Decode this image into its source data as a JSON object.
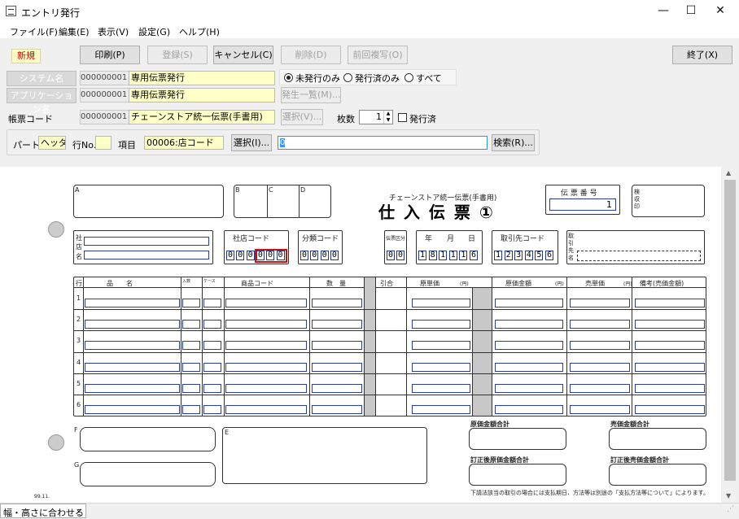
{
  "window": {
    "title": "エントリ発行",
    "minimize": "—",
    "maximize": "☐",
    "close": "✕"
  },
  "menu": [
    "ファイル(F)",
    "編集(E)",
    "表示(V)",
    "設定(G)",
    "ヘルプ(H)"
  ],
  "toolbar": {
    "mode_badge": "新規",
    "print": "印刷(P)",
    "register": "登録(S)",
    "cancel": "キャンセル(C)",
    "delete": "削除(D)",
    "prev_copy": "前回複写(O)",
    "exit": "終了(X)"
  },
  "form": {
    "system_label": "システム名",
    "system_code": "000000001",
    "system_name": "専用伝票発行",
    "app_label": "アプリケーション名",
    "app_code": "000000001",
    "app_name": "専用伝票発行",
    "voucher_label": "帳票コード",
    "voucher_code": "000000001",
    "voucher_name": "チェーンストア統一伝票(手書用)",
    "filter_options": [
      "未発行のみ",
      "発行済のみ",
      "すべて"
    ],
    "filter_selected": "未発行のみ",
    "occurrence_list": "発生一覧(M)...",
    "select_btn": "選択(V)...",
    "copies_label": "枚数",
    "copies_value": "1",
    "issued_label": "発行済",
    "part_label": "パート",
    "part_value": "ヘッダ",
    "row_label": "行No.",
    "row_value": "",
    "item_label": "項目",
    "item_value": "00006:店コード",
    "item_select": "選択(I)...",
    "search_value": "0",
    "search_btn": "検索(R)..."
  },
  "slip": {
    "header_small": "チェーンストア統一伝票(手書用)",
    "title": "仕 入 伝 票 ①",
    "box_labels": [
      "A",
      "B",
      "C",
      "D",
      "E",
      "F",
      "G"
    ],
    "slip_no_label": "伝 票 番 号",
    "slip_no_value": "1",
    "inspection": "検収印",
    "company_labels": [
      "社",
      "店",
      "名"
    ],
    "store_code_label": "社店コード",
    "store_code_digits": [
      "0",
      "0",
      "0",
      "0",
      "0",
      "0"
    ],
    "class_code_label": "分類コード",
    "class_code_digits": [
      "0",
      "0",
      "0",
      "0"
    ],
    "slip_type_label": "伝票区分",
    "slip_type_digits": [
      "0",
      "0"
    ],
    "date_labels": [
      "年",
      "月",
      "日"
    ],
    "date_digits": [
      "1",
      "8",
      "1",
      "1",
      "1",
      "6"
    ],
    "supplier_code_label": "取引先コード",
    "supplier_code_digits": [
      "1",
      "2",
      "3",
      "4",
      "5",
      "6"
    ],
    "supplier_name_label": "取引先名",
    "columns": [
      "行",
      "品　　名",
      "入数",
      "ケース",
      "商品コード",
      "数　量",
      "引合",
      "原単価",
      "原価金額",
      "売単価",
      "備考(売価金額)"
    ],
    "unit_yen": "(円)",
    "row_numbers": [
      "1",
      "2",
      "3",
      "4",
      "5",
      "6"
    ],
    "cost_total": "原価金額合計",
    "sales_total": "売価金額合計",
    "cost_total_corr": "訂正後原価金額合計",
    "sales_total_corr": "訂正後売価金額合計",
    "footnote": "下請法該当の取引の場合には支払期日、方法等は別途の「支払方法等について」によります。",
    "form_no": "99.11."
  },
  "status": {
    "zoom_option": "幅・高さに合わせる"
  },
  "colors": {
    "accent_blue": "#2b3d9a",
    "highlight_red": "#cc1111",
    "field_yellow": "#ffffc8",
    "mode_badge_text": "#cc0000"
  }
}
